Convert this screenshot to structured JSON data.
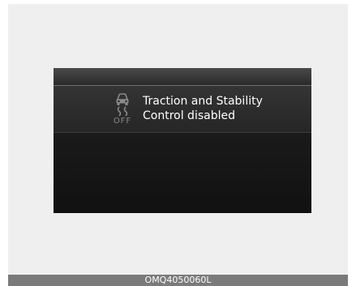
{
  "display": {
    "icon": "traction-control-off-icon",
    "off_label": "OFF",
    "message_line1": "Traction and Stability",
    "message_line2": "Control disabled"
  },
  "caption": {
    "code": "OMQ4050060L"
  },
  "colors": {
    "screen_bg": "#151515",
    "message_text": "#ffffff",
    "icon_gray": "#8a8a8a",
    "caption_bg": "#7a7a7a"
  }
}
